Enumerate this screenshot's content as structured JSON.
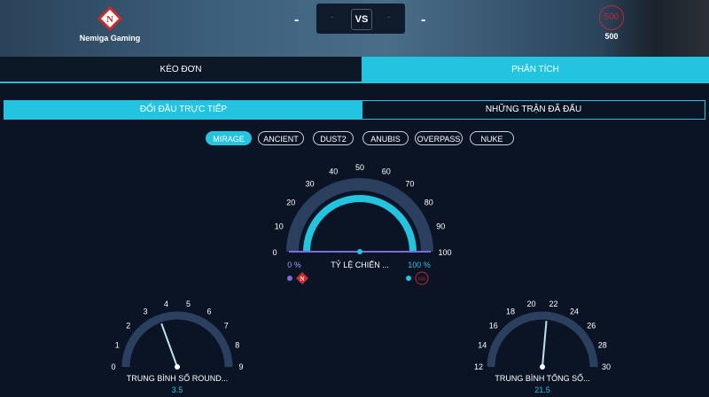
{
  "header": {
    "team_left": {
      "name": "Nemiga Gaming",
      "score": "-"
    },
    "vs_label": "VS",
    "vs_left_dash": "-",
    "vs_right_dash": "-",
    "team_right": {
      "name": "500",
      "logo_text": "500",
      "score": "-"
    }
  },
  "tabs": [
    {
      "label": "KÈO ĐƠN"
    },
    {
      "label": "PHÂN TÍCH"
    }
  ],
  "sub_tabs": [
    {
      "label": "ĐỐI ĐẦU TRỰC TIẾP"
    },
    {
      "label": "NHỮNG TRẬN ĐÃ ĐẤU"
    }
  ],
  "maps": [
    {
      "label": "MIRAGE",
      "active": true
    },
    {
      "label": "ANCIENT",
      "active": false
    },
    {
      "label": "DUST2",
      "active": false
    },
    {
      "label": "ANUBIS",
      "active": false
    },
    {
      "label": "OVERPASS",
      "active": false
    },
    {
      "label": "NUKE",
      "active": false
    }
  ],
  "gauges": {
    "win_rate": {
      "ticks": [
        "0",
        "10",
        "20",
        "30",
        "40",
        "50",
        "60",
        "70",
        "80",
        "90",
        "100"
      ],
      "title": "TỶ LỆ CHIẾN ...",
      "left_pct": "0 %",
      "right_pct": "100 %",
      "value": 100,
      "min": 0,
      "max": 100,
      "right_logo": "500"
    },
    "avg_rounds": {
      "ticks": [
        "0",
        "1",
        "2",
        "3",
        "4",
        "5",
        "6",
        "7",
        "8",
        "9"
      ],
      "title": "TRUNG BÌNH SỐ ROUND...",
      "value_text": "3.5",
      "value": 3.5,
      "min": 0,
      "max": 9
    },
    "avg_total": {
      "ticks": [
        "12",
        "14",
        "16",
        "18",
        "20",
        "22",
        "24",
        "26",
        "28",
        "30"
      ],
      "title": "TRUNG BÌNH TỔNG SỐ...",
      "value_text": "21.5",
      "value": 21.5,
      "min": 12,
      "max": 30
    }
  },
  "colors": {
    "accent": "#23c4e0",
    "arc_bg": "#2b3f5e",
    "needle": "#b9e4ee",
    "left_dot": "#7c6ae0",
    "logo_red": "#c52637"
  }
}
